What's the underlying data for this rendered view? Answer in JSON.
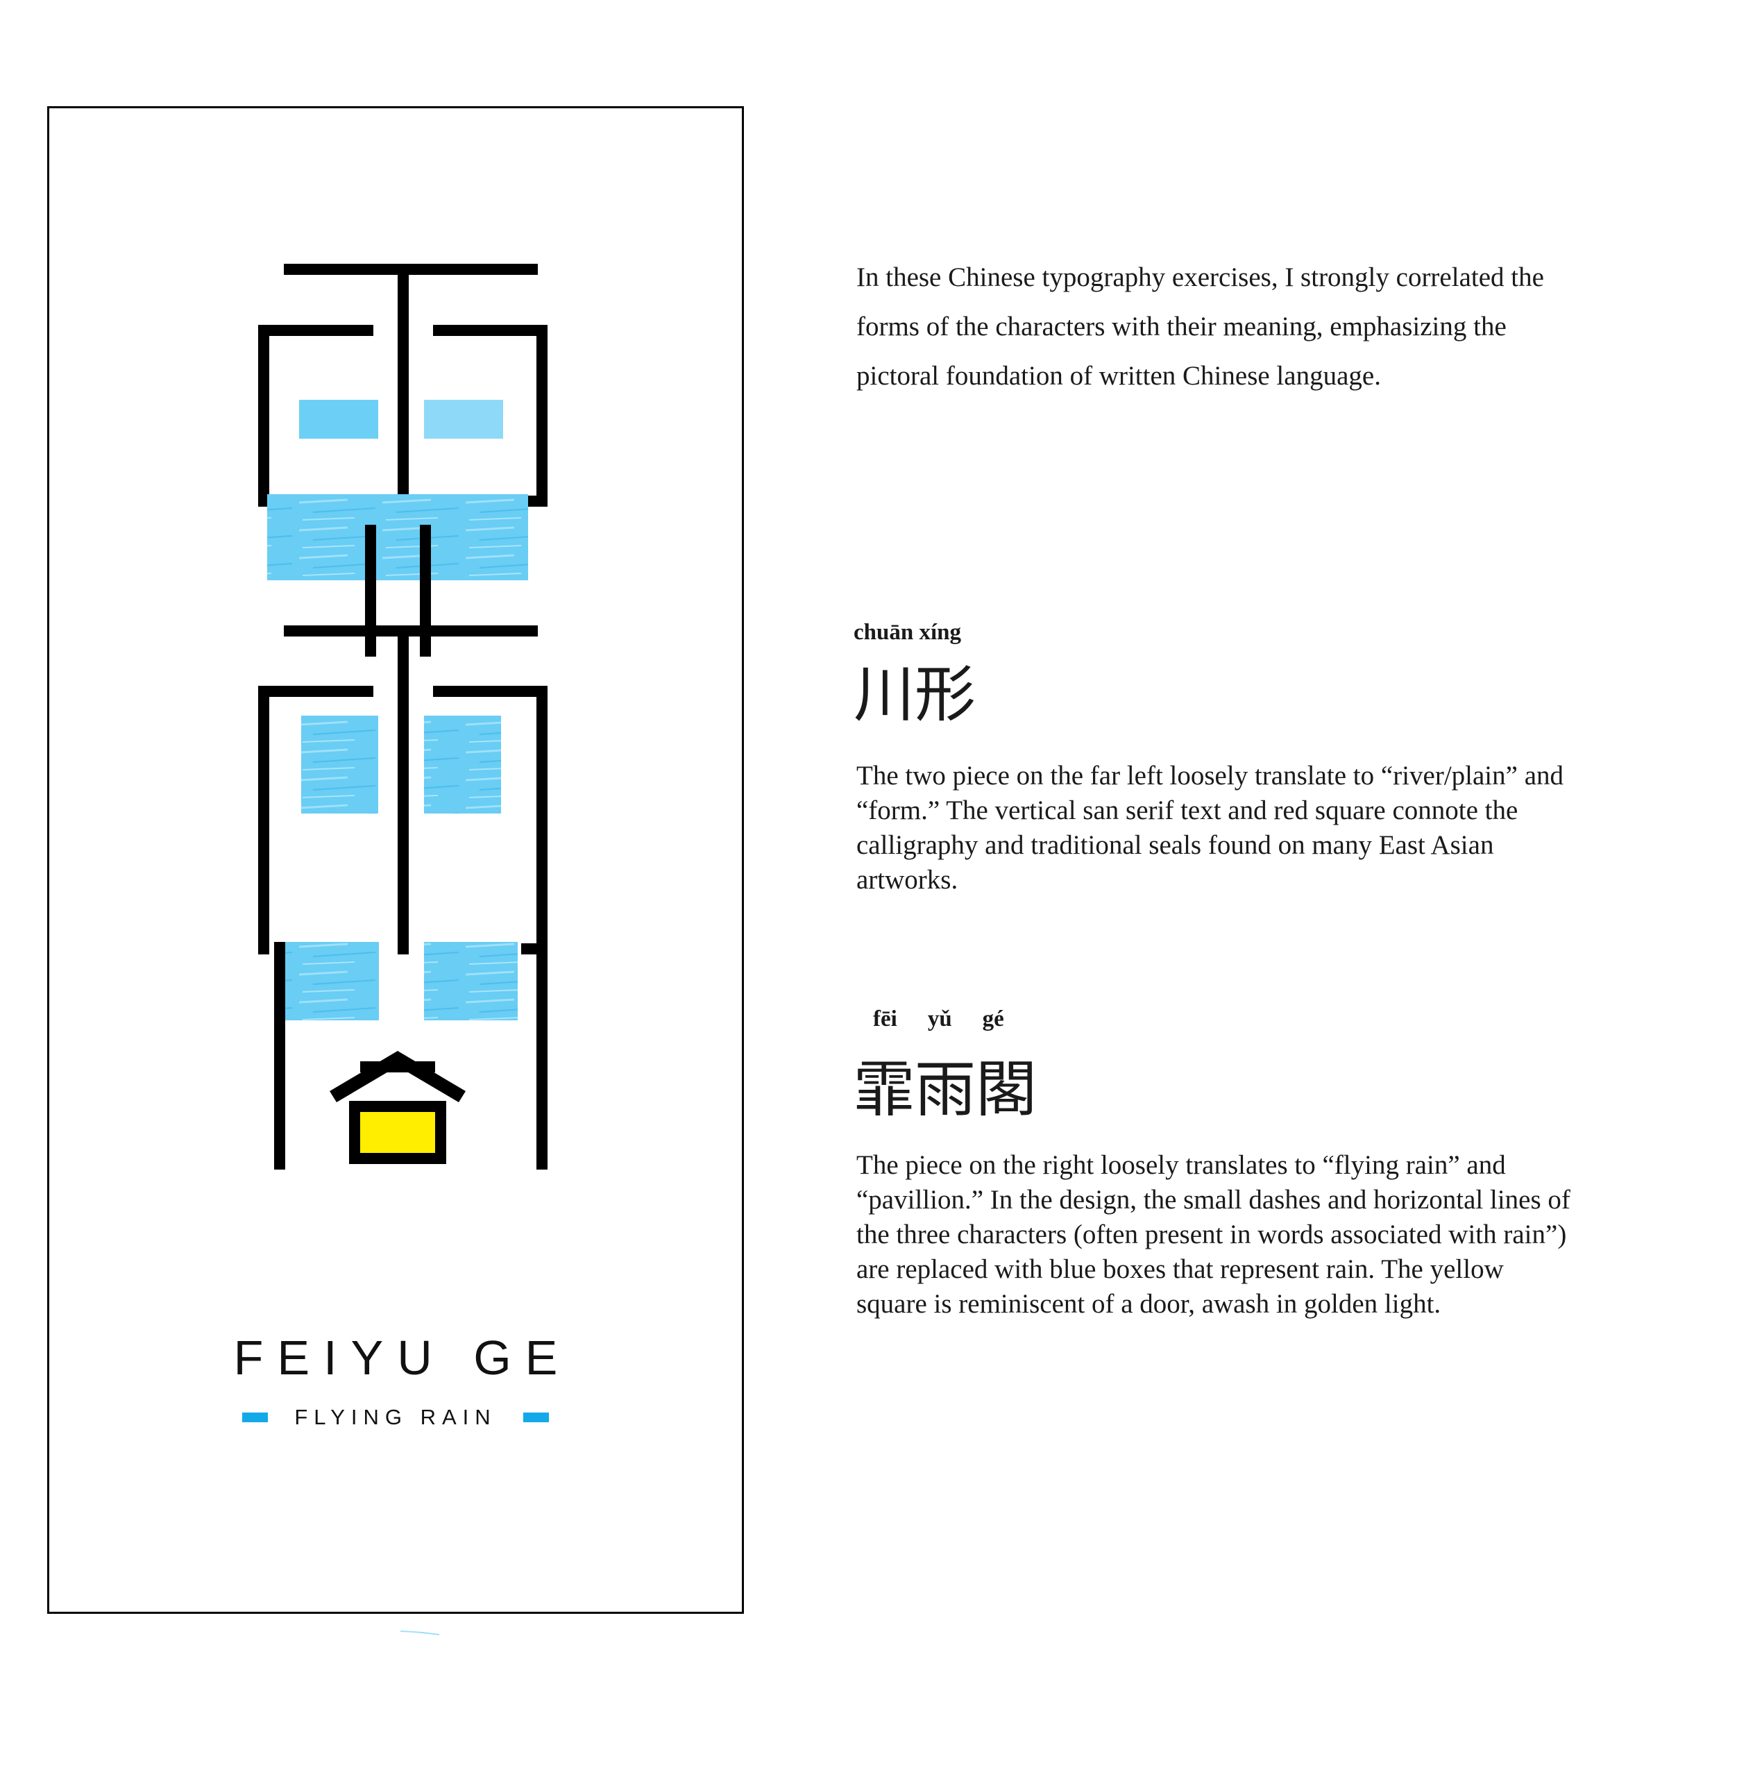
{
  "colors": {
    "rain_blue": "#5ec8f2",
    "rain_blue_light": "#8fd9f8",
    "door_yellow": "#ffee00",
    "stroke_black": "#000000",
    "dash_blue": "#13a9e8"
  },
  "poster": {
    "title": "FEIYU GE",
    "subtitle": "FLYING RAIN"
  },
  "intro": "In these Chinese typography exercises, I strongly correlated the forms of the characters with their meaning, emphasizing the pictoral foundation of written Chinese language.",
  "section1": {
    "pinyin": "chuān xíng",
    "hanzi": "川形",
    "body": "The two piece on the far left loosely translate to “river/plain” and “form.” The vertical san serif text and red square connote the calligraphy and traditional seals found on many East Asian artworks."
  },
  "section2": {
    "pinyin": [
      "fēi",
      "yǔ",
      "gé"
    ],
    "hanzi": "霏雨閣",
    "body": "The piece on the right loosely translates to “flying rain” and “pavillion.” In the design, the small dashes and horizontal lines of the three characters (often present in words associated with rain”) are replaced with blue boxes that represent rain. The yellow square is reminiscent of a door, awash in golden light."
  }
}
